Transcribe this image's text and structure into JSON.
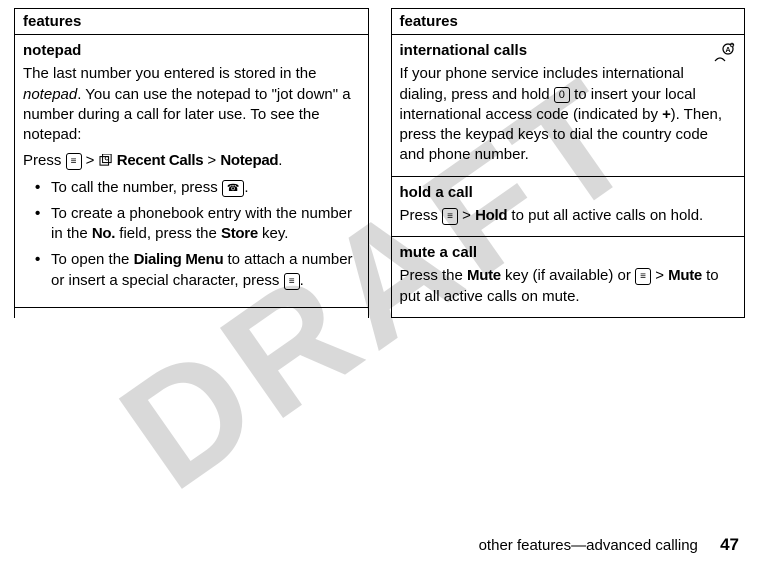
{
  "watermark": "DRAFT",
  "left": {
    "header": "features",
    "notepad": {
      "title": "notepad",
      "para1a": "The last number you entered is stored in the ",
      "para1b": "notepad",
      "para1c": ". You can use the notepad to \"jot down\" a number during a call for later use. To see the notepad:",
      "pressPrefix": "Press ",
      "gt": " > ",
      "recentCalls": "Recent Calls",
      "notepadLabel": "Notepad",
      "period": ".",
      "bullet1a": "To call the number, press ",
      "bullet1b": ".",
      "bullet2a": "To create a phonebook entry with the number in the ",
      "bullet2b": "No.",
      "bullet2c": " field, press the ",
      "bullet2d": "Store",
      "bullet2e": " key.",
      "bullet3a": "To open the ",
      "bullet3b": "Dialing Menu",
      "bullet3c": " to attach a number or insert a special character, press ",
      "bullet3d": "."
    }
  },
  "right": {
    "header": "features",
    "intl": {
      "title": "international calls",
      "para1a": "If your phone service includes international dialing, press and hold ",
      "para1b": " to insert your local international access code (indicated by ",
      "plus": "+",
      "para1c": "). Then, press the keypad keys to dial the country code and phone number."
    },
    "hold": {
      "title": "hold a call",
      "pressPrefix": "Press ",
      "gt": " > ",
      "holdLabel": "Hold",
      "rest": " to put all active calls on hold."
    },
    "mute": {
      "title": "mute a call",
      "para1a": "Press the ",
      "muteKey": "Mute",
      "para1b": " key (if available) or ",
      "gt": " > ",
      "muteLabel": "Mute",
      "para1c": " to put all active calls on mute."
    }
  },
  "footer": {
    "text": "other features—advanced calling",
    "page": "47"
  }
}
